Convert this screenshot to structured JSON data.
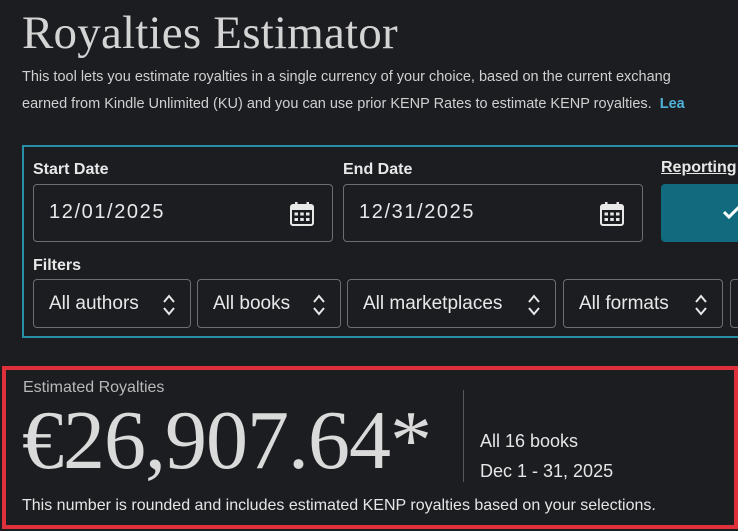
{
  "header": {
    "title": "Royalties Estimator",
    "description_line1": "This tool lets you estimate royalties in a single currency of your choice, based on the current exchang",
    "description_line2": "earned from Kindle Unlimited (KU) and you can use prior KENP Rates to estimate KENP royalties.",
    "learn_more_link": "Lea"
  },
  "filters": {
    "start_date_label": "Start Date",
    "start_date_value": "12/01/2025",
    "end_date_label": "End Date",
    "end_date_value": "12/31/2025",
    "reporting_label": "Reporting",
    "filters_label": "Filters",
    "selects": {
      "authors": "All authors",
      "books": "All books",
      "marketplaces": "All marketplaces",
      "formats": "All formats"
    }
  },
  "result": {
    "label": "Estimated Royalties",
    "value": "€26,907.64*",
    "books_summary": "All 16 books",
    "date_summary": "Dec 1 - 31, 2025",
    "footnote": "This number is rounded and includes estimated KENP royalties based on your selections."
  },
  "colors": {
    "background": "#1b1d20",
    "filter_border": "#2a8ea8",
    "result_border": "#e0303c",
    "button": "#126a7f",
    "link": "#4fb3d9"
  }
}
